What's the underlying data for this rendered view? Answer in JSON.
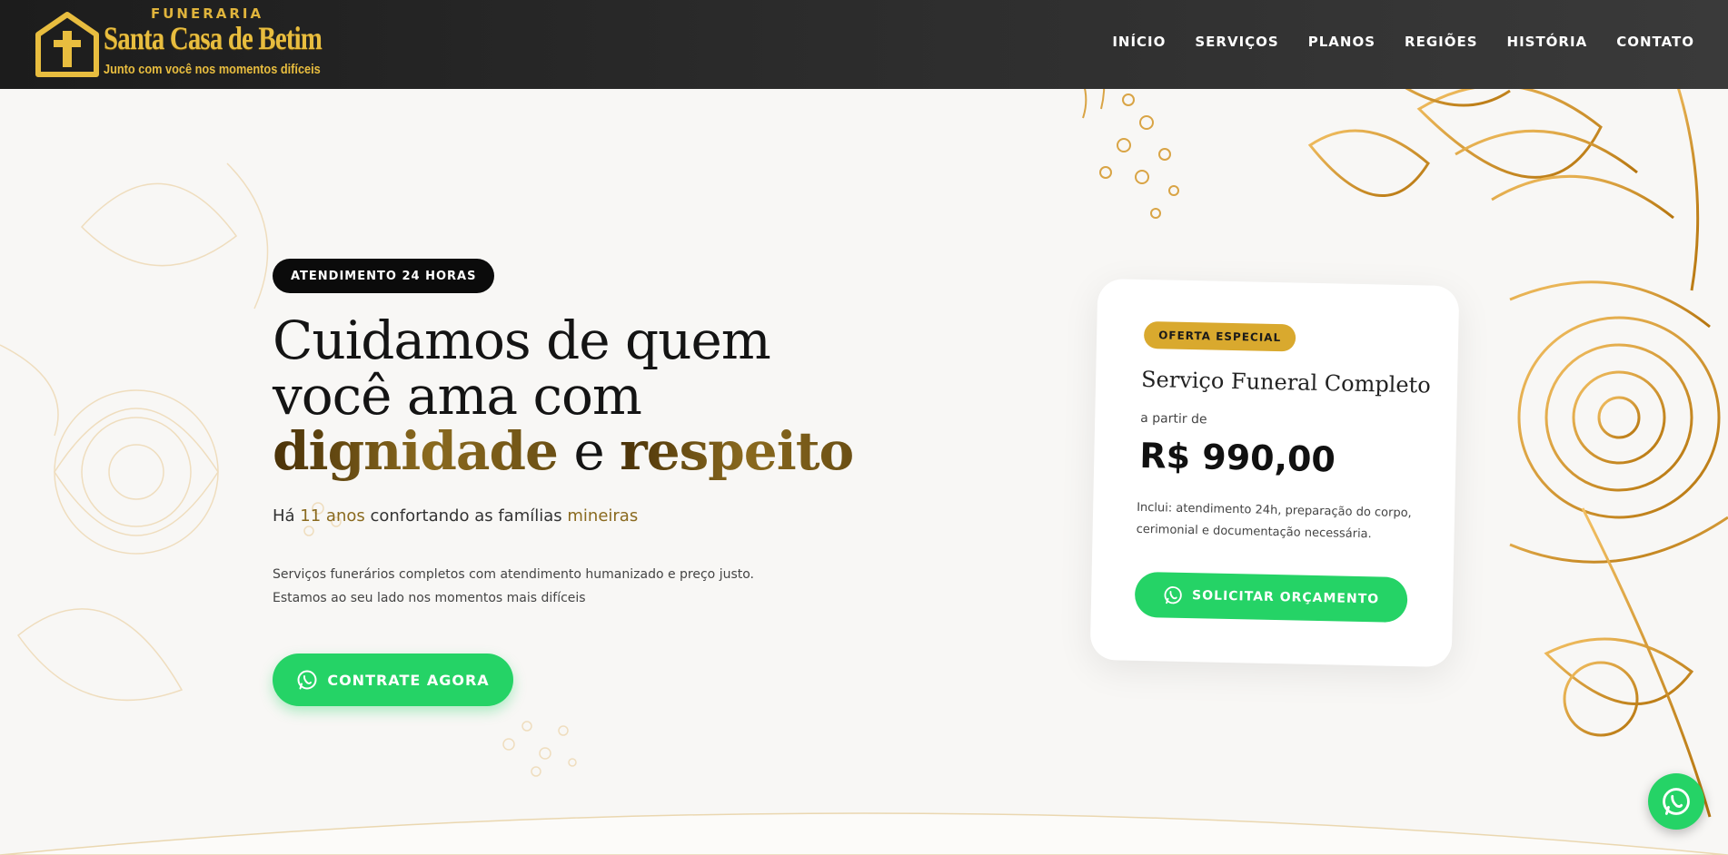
{
  "brand": {
    "line1": "FUNERARIA",
    "line2": "Santa Casa de Betim",
    "line3": "Junto com você nos momentos difíceis"
  },
  "nav": [
    "INÍCIO",
    "SERVIÇOS",
    "PLANOS",
    "REGIÕES",
    "HISTÓRIA",
    "CONTATO"
  ],
  "hero": {
    "badge": "ATENDIMENTO 24 HORAS",
    "headline_1": "Cuidamos de quem",
    "headline_2": "você ama com",
    "headline_gold_1": "dignidade",
    "headline_mid": " e ",
    "headline_gold_2": "respeito",
    "sub_pre": "Há ",
    "sub_years": "11 anos",
    "sub_mid": " confortando as famílias ",
    "sub_end": "mineiras",
    "desc_1": "Serviços funerários completos com atendimento humanizado e preço justo.",
    "desc_2": "Estamos ao seu lado nos momentos mais difíceis",
    "cta": "CONTRATE AGORA"
  },
  "offer": {
    "tag": "OFERTA ESPECIAL",
    "title": "Serviço Funeral Completo",
    "from": "a partir de",
    "price": "R$ 990,00",
    "includes": "Inclui: atendimento 24h, preparação do corpo, cerimonial e documentação necessária.",
    "button": "SOLICITAR ORÇAMENTO"
  },
  "icons": {
    "logo": "cross-house-icon",
    "cta": "whatsapp-icon",
    "offer_button": "whatsapp-icon",
    "floating": "whatsapp-icon"
  },
  "colors": {
    "header_bg": "#2b2b2b",
    "gold": "#d9a92e",
    "whatsapp_green": "#25d366",
    "badge_bg": "#0b0b0b"
  }
}
